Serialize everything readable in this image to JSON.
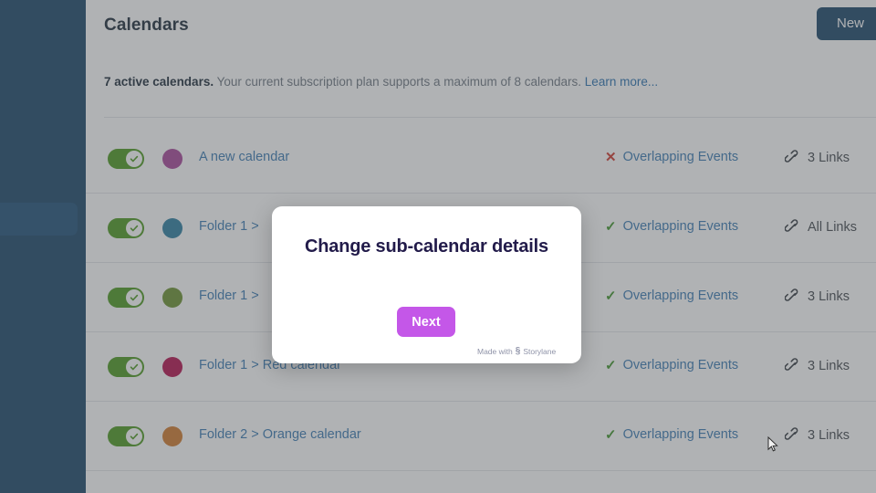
{
  "sidebar": {
    "active_item_name": "calendars-nav-item",
    "background_color": "#1b4569",
    "active_color": "#1f5078"
  },
  "header": {
    "title": "Calendars",
    "new_button_label": "New",
    "new_button_color": "#1b4569"
  },
  "notice": {
    "count_text": "7 active calendars.",
    "description": " Your current subscription plan supports a maximum of 8 calendars. ",
    "link_text": "Learn more...",
    "link_color": "#2b72b0"
  },
  "calendars": [
    {
      "name": "A new calendar",
      "color": "#a8459a",
      "enabled": true,
      "overlap_status": "bad",
      "overlap_mark": "✕",
      "overlap_label": "Overlapping Events",
      "links_label": "3 Links"
    },
    {
      "name": "Folder 1 > ",
      "color": "#2c7ea1",
      "enabled": true,
      "overlap_status": "ok",
      "overlap_mark": "✓",
      "overlap_label": "Overlapping Events",
      "links_label": "All Links"
    },
    {
      "name": "Folder 1 > ",
      "color": "#6c9230",
      "enabled": true,
      "overlap_status": "ok",
      "overlap_mark": "✓",
      "overlap_label": "Overlapping Events",
      "links_label": "3 Links"
    },
    {
      "name": "Folder 1 > Red calendar",
      "color": "#b5104e",
      "enabled": true,
      "overlap_status": "ok",
      "overlap_mark": "✓",
      "overlap_label": "Overlapping Events",
      "links_label": "3 Links"
    },
    {
      "name": "Folder 2 > Orange calendar",
      "color": "#d17a2c",
      "enabled": true,
      "overlap_status": "ok",
      "overlap_mark": "✓",
      "overlap_label": "Overlapping Events",
      "links_label": "3 Links"
    }
  ],
  "tour": {
    "title": "Change sub-calendar details",
    "next_label": "Next",
    "badge_prefix": "Made with",
    "badge_brand": "Storylane",
    "accent_color": "#c457e8",
    "title_color": "#221b4a"
  }
}
